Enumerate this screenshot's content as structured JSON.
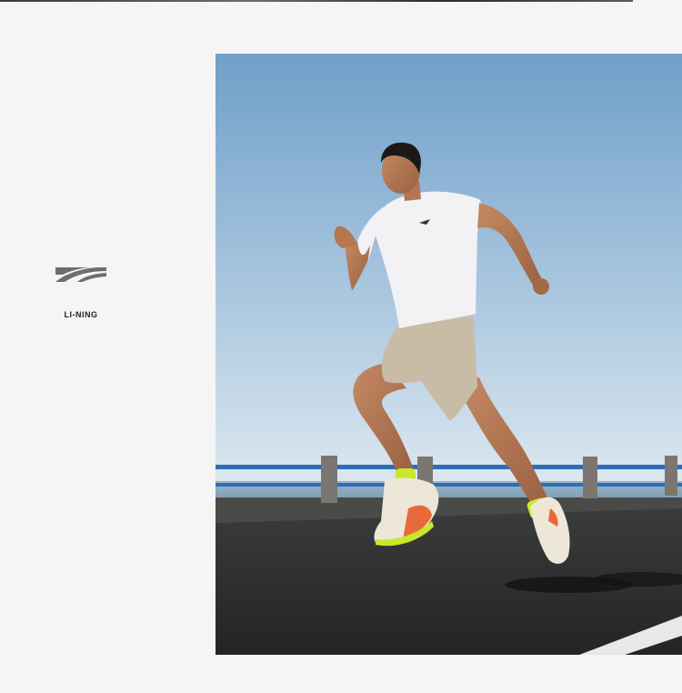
{
  "brand": {
    "name": "LI-NING",
    "logo_icon": "li-ning-logo-icon",
    "logo_color": "#6e6e6e"
  },
  "photo": {
    "subject": "runner-jumping-on-seaside-road",
    "sky_top_color": "#6f9fc9",
    "sky_bottom_color": "#dbe7ef",
    "road_color": "#2e2f31",
    "rail_color": "#2a6fb8",
    "shoe_accent_color": "#e86a3a",
    "sock_color": "#c8e82a"
  }
}
